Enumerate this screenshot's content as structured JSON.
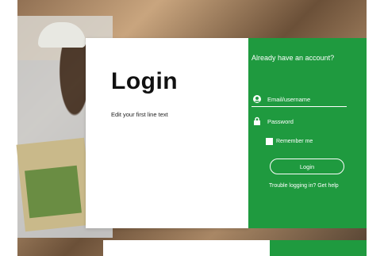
{
  "left_panel": {
    "title": "Login",
    "subtitle": "Edit your first line text"
  },
  "right_panel": {
    "heading": "Already have an account?",
    "username_placeholder": "Email/username",
    "password_placeholder": "Password",
    "remember_label": "Remember me",
    "login_button": "Login",
    "trouble_text": "Trouble logging in? Get help",
    "colors": {
      "accent": "#1f9a3f"
    }
  }
}
